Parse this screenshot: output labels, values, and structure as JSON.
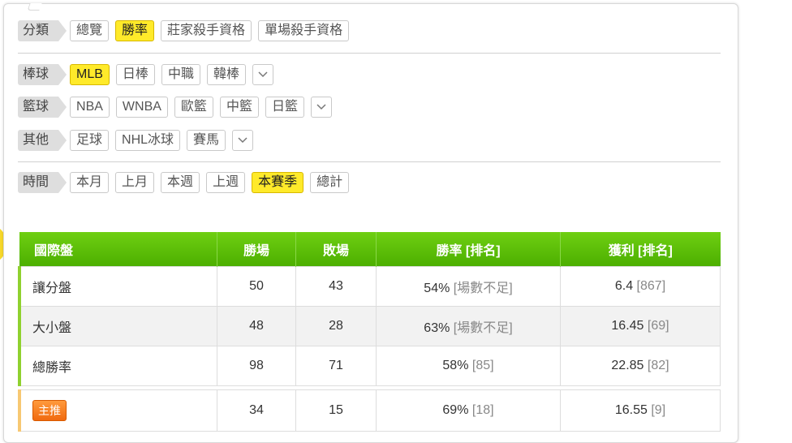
{
  "filters": {
    "category": {
      "label": "分類",
      "options": [
        "總覽",
        "勝率",
        "莊家殺手資格",
        "單場殺手資格"
      ],
      "active": 1
    },
    "baseball": {
      "label": "棒球",
      "options": [
        "MLB",
        "日棒",
        "中職",
        "韓棒"
      ],
      "active": 0
    },
    "basketball": {
      "label": "籃球",
      "options": [
        "NBA",
        "WNBA",
        "歐籃",
        "中籃",
        "日籃"
      ],
      "active": -1
    },
    "other": {
      "label": "其他",
      "options": [
        "足球",
        "NHL冰球",
        "賽馬"
      ],
      "active": -1
    },
    "time": {
      "label": "時間",
      "options": [
        "本月",
        "上月",
        "本週",
        "上週",
        "本賽季",
        "總計"
      ],
      "active": 4
    }
  },
  "table": {
    "headers": [
      "國際盤",
      "勝場",
      "敗場",
      "勝率 [排名]",
      "獲利 [排名]"
    ],
    "rows": [
      {
        "name": "讓分盤",
        "wins": "50",
        "losses": "43",
        "rate": "54%",
        "rate_rank": "[場數不足]",
        "profit": "6.4",
        "profit_rank": "[867]"
      },
      {
        "name": "大小盤",
        "wins": "48",
        "losses": "28",
        "rate": "63%",
        "rate_rank": "[場數不足]",
        "profit": "16.45",
        "profit_rank": "[69]"
      },
      {
        "name": "總勝率",
        "wins": "98",
        "losses": "71",
        "rate": "58%",
        "rate_rank": "[85]",
        "profit": "22.85",
        "profit_rank": "[82]"
      }
    ],
    "home": {
      "badge": "主推",
      "wins": "34",
      "losses": "15",
      "rate": "69%",
      "rate_rank": "[18]",
      "profit": "16.55",
      "profit_rank": "[9]"
    }
  },
  "icons": {
    "dropdown": "chevron-down-icon"
  },
  "colors": {
    "accent": "#ffea2a",
    "header": "#5cbc05",
    "home_badge": "#f07a1c"
  }
}
